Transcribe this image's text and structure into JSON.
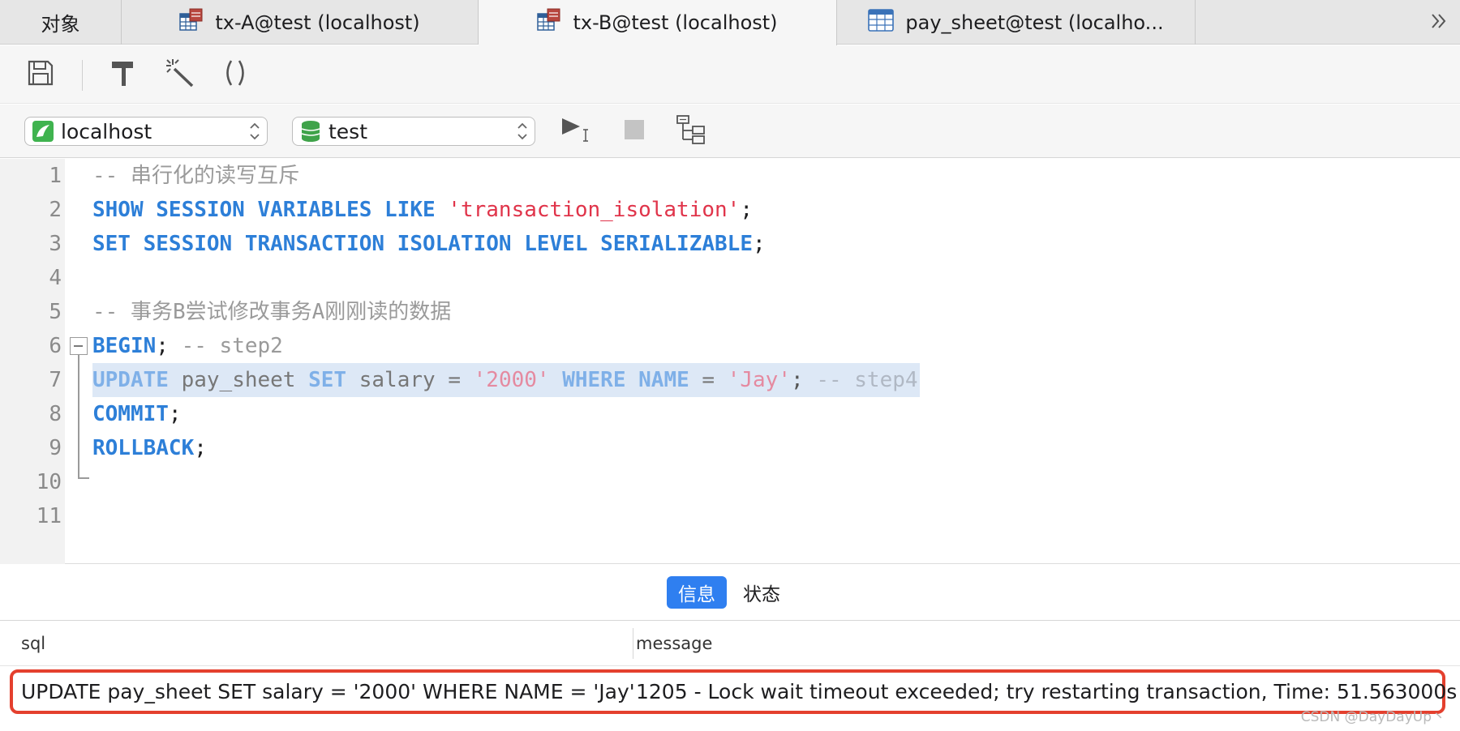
{
  "tabs": [
    {
      "label": "对象",
      "icon": "none",
      "active": false
    },
    {
      "label": "tx-A@test (localhost)",
      "icon": "query-icon",
      "active": false
    },
    {
      "label": "tx-B@test (localhost)",
      "icon": "query-icon",
      "active": true
    },
    {
      "label": "pay_sheet@test (localho...",
      "icon": "table-icon",
      "active": false
    }
  ],
  "connection": {
    "server": "localhost",
    "database": "test"
  },
  "editor": {
    "line_numbers": [
      "1",
      "2",
      "3",
      "4",
      "5",
      "6",
      "7",
      "8",
      "9",
      "10",
      "11"
    ],
    "lines": [
      [
        {
          "t": "-- 串行化的读写互斥",
          "c": "cmt"
        }
      ],
      [
        {
          "t": "SHOW SESSION VARIABLES LIKE ",
          "c": "kw"
        },
        {
          "t": "'transaction_isolation'",
          "c": "str"
        },
        {
          "t": ";",
          "c": "punct"
        }
      ],
      [
        {
          "t": "SET SESSION TRANSACTION ISOLATION LEVEL SERIALIZABLE",
          "c": "kw"
        },
        {
          "t": ";",
          "c": "punct"
        }
      ],
      [],
      [
        {
          "t": "-- 事务B尝试修改事务A刚刚读的数据",
          "c": "cmt"
        }
      ],
      [
        {
          "t": "BEGIN",
          "c": "kw"
        },
        {
          "t": "; ",
          "c": "punct"
        },
        {
          "t": "-- step2",
          "c": "cmt"
        }
      ],
      [
        {
          "t": "UPDATE ",
          "c": "kw"
        },
        {
          "t": "pay_sheet ",
          "c": "plain"
        },
        {
          "t": "SET ",
          "c": "kw"
        },
        {
          "t": "salary = ",
          "c": "plain"
        },
        {
          "t": "'2000' ",
          "c": "str"
        },
        {
          "t": "WHERE NAME ",
          "c": "kw"
        },
        {
          "t": "= ",
          "c": "plain"
        },
        {
          "t": "'Jay'",
          "c": "str"
        },
        {
          "t": "; ",
          "c": "punct"
        },
        {
          "t": "-- step4",
          "c": "cmt"
        }
      ],
      [
        {
          "t": "COMMIT",
          "c": "kw"
        },
        {
          "t": ";",
          "c": "punct"
        }
      ],
      [
        {
          "t": "ROLLBACK",
          "c": "kw"
        },
        {
          "t": ";",
          "c": "punct"
        }
      ],
      [],
      []
    ],
    "highlighted_line": 7
  },
  "result_tabs": [
    {
      "label": "信息",
      "active": true
    },
    {
      "label": "状态",
      "active": false
    }
  ],
  "results": {
    "columns": [
      "sql",
      "message"
    ],
    "rows": [
      {
        "sql": "UPDATE pay_sheet SET salary = '2000' WHERE NAME = 'Jay'",
        "message": "1205 - Lock wait timeout exceeded; try restarting transaction, Time: 51.563000s"
      }
    ]
  },
  "watermark": "CSDN @DayDayUp丶",
  "colors": {
    "keyword": "#2d7fd8",
    "string": "#e0344a",
    "comment": "#9a9a9a",
    "active_tab_button": "#2f7ff0",
    "error_outline": "#e4402e"
  }
}
